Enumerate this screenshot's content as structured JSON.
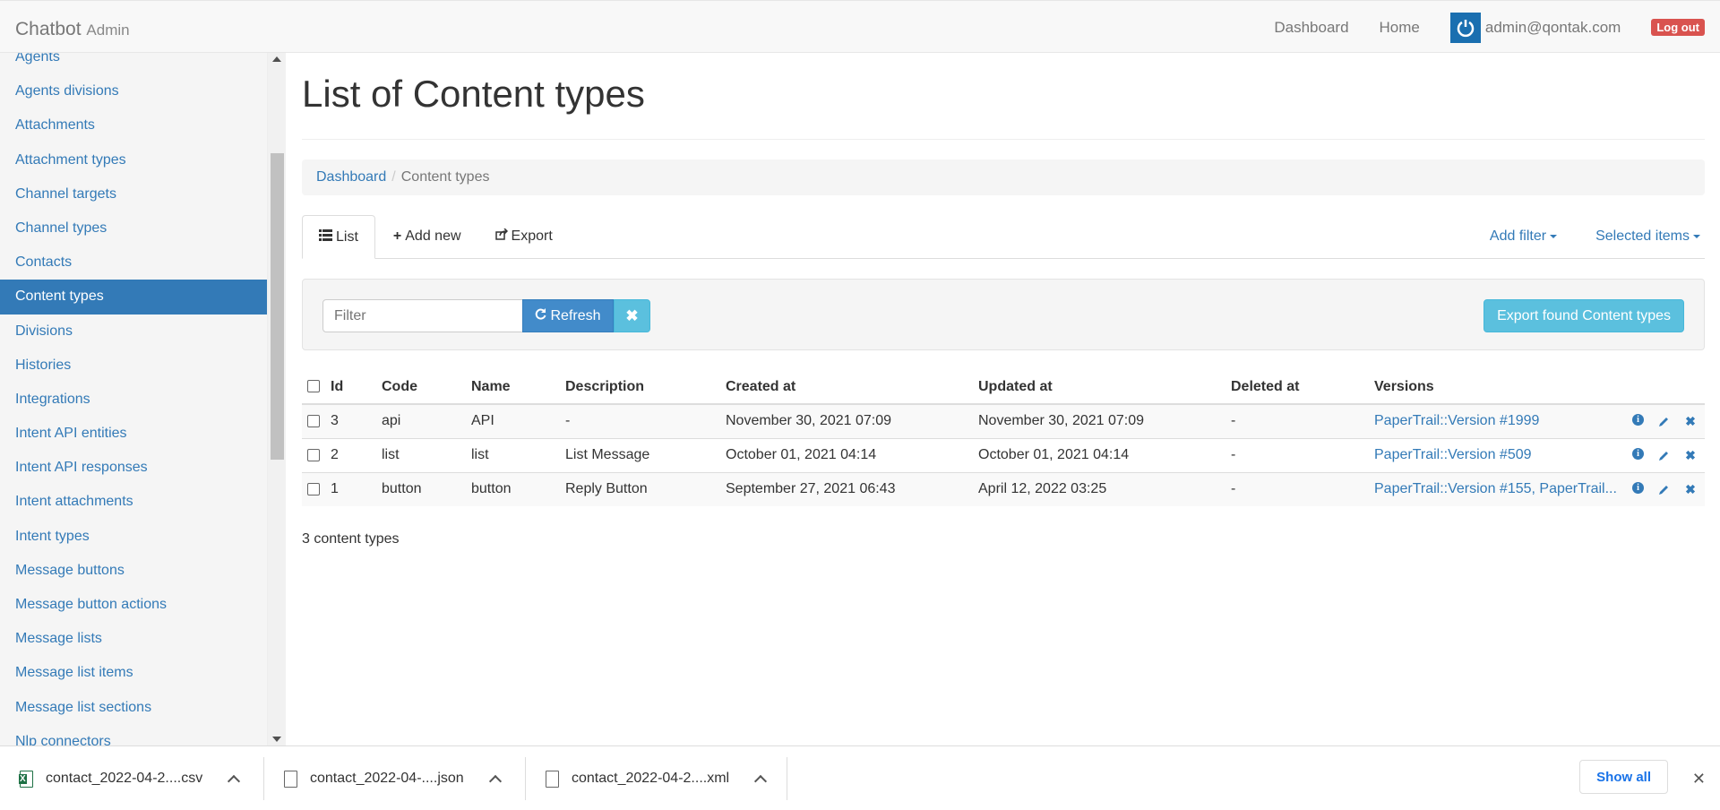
{
  "navbar": {
    "brand": "Chatbot",
    "brand_sub": "Admin",
    "links": [
      "Dashboard",
      "Home"
    ],
    "user_email": "admin@qontak.com",
    "logout": "Log out"
  },
  "sidebar": {
    "items": [
      {
        "label": "Agents"
      },
      {
        "label": "Agents divisions"
      },
      {
        "label": "Attachments"
      },
      {
        "label": "Attachment types"
      },
      {
        "label": "Channel targets"
      },
      {
        "label": "Channel types"
      },
      {
        "label": "Contacts"
      },
      {
        "label": "Content types",
        "active": true
      },
      {
        "label": "Divisions"
      },
      {
        "label": "Histories"
      },
      {
        "label": "Integrations"
      },
      {
        "label": "Intent API entities"
      },
      {
        "label": "Intent API responses"
      },
      {
        "label": "Intent attachments"
      },
      {
        "label": "Intent types"
      },
      {
        "label": "Message buttons"
      },
      {
        "label": "Message button actions"
      },
      {
        "label": "Message lists"
      },
      {
        "label": "Message list items"
      },
      {
        "label": "Message list sections"
      },
      {
        "label": "Nlp connectors"
      }
    ]
  },
  "page": {
    "title": "List of Content types",
    "breadcrumb": {
      "root": "Dashboard",
      "current": "Content types"
    }
  },
  "tabs": {
    "list": "List",
    "add_new": "Add new",
    "export": "Export",
    "add_filter": "Add filter",
    "selected_items": "Selected items"
  },
  "filter": {
    "placeholder": "Filter",
    "refresh": "Refresh",
    "export_found": "Export found Content types"
  },
  "table": {
    "headers": [
      "Id",
      "Code",
      "Name",
      "Description",
      "Created at",
      "Updated at",
      "Deleted at",
      "Versions"
    ],
    "rows": [
      {
        "id": "3",
        "code": "api",
        "name": "API",
        "description": "-",
        "created_at": "November 30, 2021 07:09",
        "updated_at": "November 30, 2021 07:09",
        "deleted_at": "-",
        "versions": "PaperTrail::Version #1999"
      },
      {
        "id": "2",
        "code": "list",
        "name": "list",
        "description": "List Message",
        "created_at": "October 01, 2021 04:14",
        "updated_at": "October 01, 2021 04:14",
        "deleted_at": "-",
        "versions": "PaperTrail::Version #509"
      },
      {
        "id": "1",
        "code": "button",
        "name": "button",
        "description": "Reply Button",
        "created_at": "September 27, 2021 06:43",
        "updated_at": "April 12, 2022 03:25",
        "deleted_at": "-",
        "versions": "PaperTrail::Version #155, PaperTrail..."
      }
    ],
    "count_label": "3 content types"
  },
  "downloads": {
    "files": [
      {
        "name": "contact_2022-04-2....csv",
        "icon": "excel-file-icon"
      },
      {
        "name": "contact_2022-04-....json",
        "icon": "file-icon"
      },
      {
        "name": "contact_2022-04-2....xml",
        "icon": "file-icon"
      }
    ],
    "show_all": "Show all"
  },
  "colors": {
    "accent": "#337ab7",
    "info": "#5bc0de",
    "danger": "#d9534f"
  }
}
